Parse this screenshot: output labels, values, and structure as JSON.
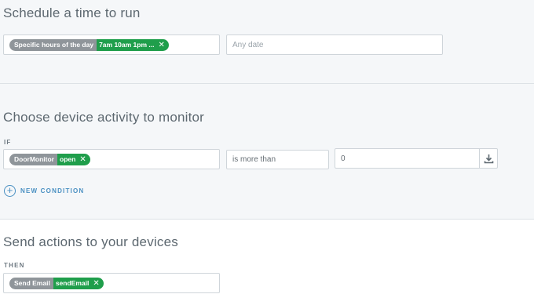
{
  "schedule": {
    "heading": "Schedule a time to run",
    "time_chip": {
      "label": "Specific hours of the day",
      "value": "7am 10am 1pm ..."
    },
    "date_placeholder": "Any date"
  },
  "activity": {
    "heading": "Choose device activity to monitor",
    "if_label": "IF",
    "device_chip": {
      "label": "DoorMonitor",
      "value": "open"
    },
    "operator": "is more than",
    "threshold": "0",
    "new_condition_label": "NEW CONDITION"
  },
  "actions": {
    "heading": "Send actions to your devices",
    "then_label": "THEN",
    "action_chip": {
      "label": "Send Email",
      "value": "sendEmail"
    }
  },
  "icons": {
    "remove": "close-icon",
    "add": "plus-circle-icon",
    "download": "download-icon"
  },
  "colors": {
    "chip_label_bg": "#8f959a",
    "chip_value_bg": "#1f9e4b",
    "accent": "#4a90c2",
    "section_bg": "#f5f7f9"
  }
}
